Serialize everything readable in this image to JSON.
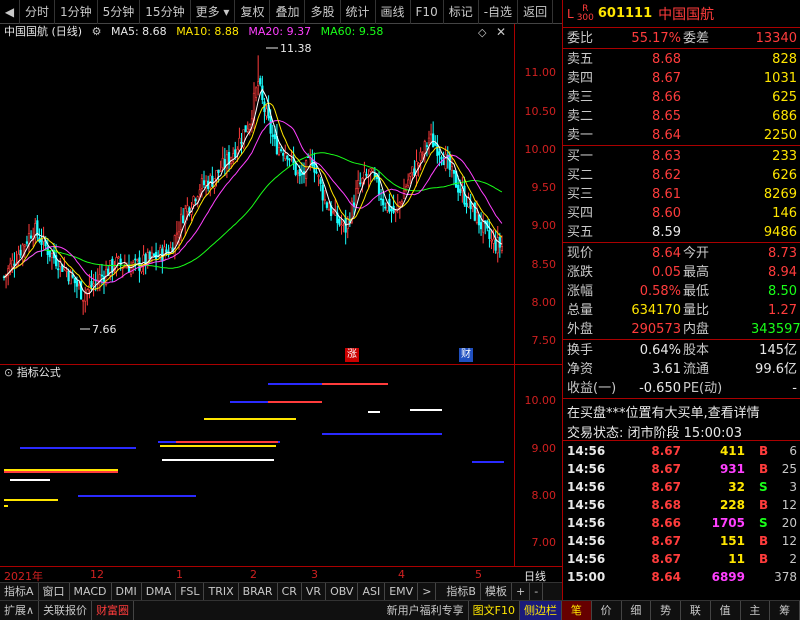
{
  "toolbar": {
    "items": [
      "分时",
      "1分钟",
      "5分钟",
      "15分钟",
      "更多",
      "复权",
      "叠加",
      "多股",
      "统计",
      "画线",
      "F10",
      "标记",
      "-自选",
      "返回"
    ]
  },
  "chart": {
    "stock_title": "中国国航 (日线)",
    "ma5": "MA5: 8.68",
    "ma10": "MA10: 8.88",
    "ma20": "MA20: 9.37",
    "ma60": "MA60: 9.58",
    "high_label": "11.38",
    "low_label": "7.66",
    "badge_zhang": "涨",
    "badge_cai": "财",
    "price_ticks": [
      "11.00",
      "10.50",
      "10.00",
      "9.50",
      "9.00",
      "8.50",
      "8.00",
      "7.50"
    ],
    "indicator_title": "指标公式",
    "ind_ticks": [
      "10.00",
      "9.00",
      "8.00",
      "7.00"
    ],
    "date_ticks": [
      "2021年",
      "12",
      "1",
      "2",
      "3",
      "4",
      "5"
    ],
    "period": "日线"
  },
  "chart_data": {
    "type": "candlestick",
    "title": "中国国航 (日线)",
    "ylim": [
      7.3,
      11.6
    ],
    "series": [
      {
        "name": "MA5",
        "last": 8.68,
        "color": "#ffffff"
      },
      {
        "name": "MA10",
        "last": 8.88,
        "color": "#ffe600"
      },
      {
        "name": "MA20",
        "last": 9.37,
        "color": "#ff40ff"
      },
      {
        "name": "MA60",
        "last": 9.58,
        "color": "#19ff19"
      }
    ],
    "annotations": [
      {
        "label": "11.38",
        "y": 11.38
      },
      {
        "label": "7.66",
        "y": 7.66
      }
    ]
  },
  "colors": {
    "up": "#ff3c3c",
    "down": "#19ffff",
    "accent": "#a00000"
  },
  "panel": {
    "code": "601111",
    "name": "中国国航",
    "l": "L",
    "r": "R",
    "r_sub": "300",
    "weibi_label": "委比",
    "weibi": "55.17%",
    "weicha_label": "委差",
    "weicha": "13340",
    "asks": [
      {
        "label": "卖五",
        "price": "8.68",
        "vol": "828"
      },
      {
        "label": "卖四",
        "price": "8.67",
        "vol": "1031"
      },
      {
        "label": "卖三",
        "price": "8.66",
        "vol": "625"
      },
      {
        "label": "卖二",
        "price": "8.65",
        "vol": "686"
      },
      {
        "label": "卖一",
        "price": "8.64",
        "vol": "2250"
      }
    ],
    "bids": [
      {
        "label": "买一",
        "price": "8.63",
        "vol": "233"
      },
      {
        "label": "买二",
        "price": "8.62",
        "vol": "626"
      },
      {
        "label": "买三",
        "price": "8.61",
        "vol": "8269"
      },
      {
        "label": "买四",
        "price": "8.60",
        "vol": "146"
      },
      {
        "label": "买五",
        "price": "8.59",
        "vol": "9486"
      }
    ],
    "stats": [
      {
        "l1": "现价",
        "v1": "8.64",
        "l2": "今开",
        "v2": "8.73"
      },
      {
        "l1": "涨跌",
        "v1": "0.05",
        "l2": "最高",
        "v2": "8.94"
      },
      {
        "l1": "涨幅",
        "v1": "0.58%",
        "l2": "最低",
        "v2": "8.50"
      },
      {
        "l1": "总量",
        "v1": "634170",
        "l2": "量比",
        "v2": "1.27"
      },
      {
        "l1": "外盘",
        "v1": "290573",
        "l2": "内盘",
        "v2": "343597"
      }
    ],
    "stats2": [
      {
        "l1": "换手",
        "v1": "0.64%",
        "l2": "股本",
        "v2": "145亿"
      },
      {
        "l1": "净资",
        "v1": "3.61",
        "l2": "流通",
        "v2": "99.6亿"
      },
      {
        "l1": "收益(一)",
        "v1": "-0.650",
        "l2": "PE(动)",
        "v2": "-"
      }
    ],
    "message": "在买盘***位置有大买单,查看详情",
    "status_label": "交易状态: 闭市阶段",
    "status_time": "15:00:03",
    "trades": [
      {
        "time": "14:56",
        "price": "8.67",
        "vol": "411",
        "bs": "B",
        "cnt": "6"
      },
      {
        "time": "14:56",
        "price": "8.67",
        "vol": "931",
        "bs": "B",
        "cnt": "25"
      },
      {
        "time": "14:56",
        "price": "8.67",
        "vol": "32",
        "bs": "S",
        "cnt": "3"
      },
      {
        "time": "14:56",
        "price": "8.68",
        "vol": "228",
        "bs": "B",
        "cnt": "12"
      },
      {
        "time": "14:56",
        "price": "8.66",
        "vol": "1705",
        "bs": "S",
        "cnt": "20"
      },
      {
        "time": "14:56",
        "price": "8.67",
        "vol": "151",
        "bs": "B",
        "cnt": "12"
      },
      {
        "time": "14:56",
        "price": "8.67",
        "vol": "11",
        "bs": "B",
        "cnt": "2"
      },
      {
        "time": "15:00",
        "price": "8.64",
        "vol": "6899",
        "bs": "",
        "cnt": "378"
      }
    ]
  },
  "tabs": [
    "指标A",
    "窗口",
    "MACD",
    "DMI",
    "DMA",
    "FSL",
    "TRIX",
    "BRAR",
    "CR",
    "VR",
    "OBV",
    "ASI",
    "EMV",
    ">",
    "指标B",
    "模板",
    "+",
    "-"
  ],
  "bottom": {
    "items": [
      "扩展∧",
      "关联报价",
      "财富圈"
    ],
    "right_items": [
      "新用户福利专享",
      "图文F10",
      "侧边栏"
    ],
    "right_tabs": [
      "笔",
      "价",
      "细",
      "势",
      "联",
      "值",
      "主",
      "筹"
    ]
  }
}
